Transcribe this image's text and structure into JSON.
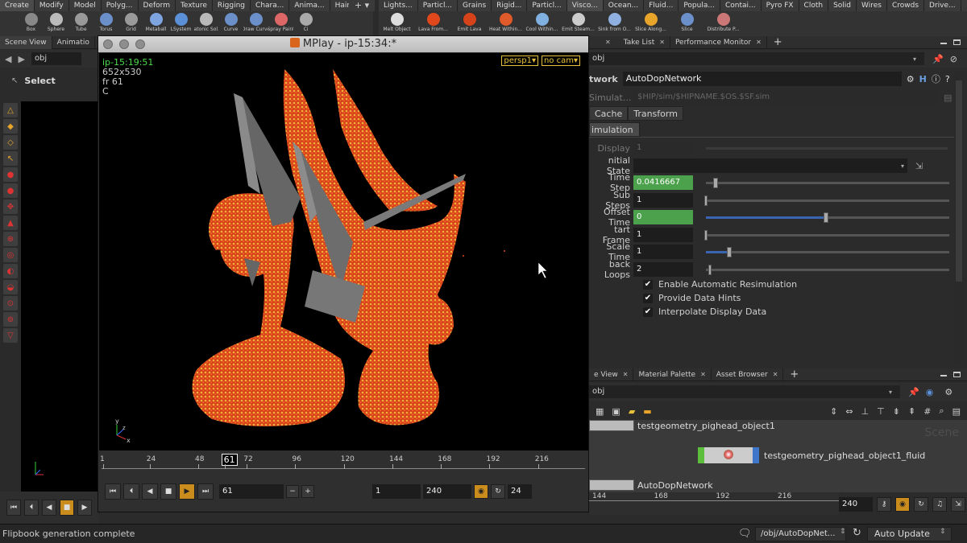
{
  "shelf_left": {
    "tabs": [
      "Create",
      "Modify",
      "Model",
      "Polyg...",
      "Deform",
      "Texture",
      "Rigging",
      "Chara...",
      "Anima...",
      "Hair"
    ],
    "tools": [
      "Box",
      "Sphere",
      "Tube",
      "Torus",
      "Grid",
      "Metaball",
      "LSystem",
      "Platonic Sol...",
      "Curve",
      "Draw Curve",
      "Spray Paint",
      "Ci"
    ]
  },
  "shelf_right": {
    "tabs": [
      "Lights...",
      "Particl...",
      "Grains",
      "Rigid...",
      "Particl...",
      "Visco...",
      "Ocean...",
      "Fluid...",
      "Popula...",
      "Contai...",
      "Pyro FX",
      "Cloth",
      "Solid",
      "Wires",
      "Crowds",
      "Drive..."
    ],
    "tools": [
      "Melt Object",
      "Lava From...",
      "Emit Lava",
      "Heat Within...",
      "Cool Within...",
      "Emit Steam...",
      "Sink from O...",
      "Slice Along...",
      "Slice",
      "Distribute P..."
    ]
  },
  "left_pane": {
    "tabs": [
      "Scene View",
      "Animatio"
    ],
    "path": "obj",
    "select_label": "Select",
    "axis_label": "x y z"
  },
  "mplay": {
    "title": "MPlay - ip-15:34:*",
    "overlay": {
      "name": "ip-15:19:51",
      "res": "652x530",
      "frame": "fr 61",
      "channel": "C"
    },
    "cam_menu": [
      "persp1▾",
      "no cam▾"
    ],
    "timeline_ticks": [
      "1",
      "24",
      "48",
      "61",
      "72",
      "96",
      "120",
      "144",
      "168",
      "192",
      "216"
    ],
    "current_frame_marker": "61",
    "frame_field": "61",
    "start_field": "1",
    "end_field": "240",
    "fps_field": "24"
  },
  "right_top": {
    "tabs": [
      "Take List",
      "Performance Monitor"
    ],
    "path": "obj",
    "node_type": "AutoDopNetwork",
    "node_label": "twork",
    "simulat_label": "Simulat...",
    "simulat_value": "$HIP/sim/$HIPNAME.$OS.$SF.sim",
    "subtabs": [
      "Cache",
      "Transform"
    ],
    "section_tab": "imulation",
    "params": [
      {
        "label": "Display",
        "value": "1"
      },
      {
        "label": "nitial State",
        "value": ""
      },
      {
        "label": "Time Step",
        "value": "0.0416667"
      },
      {
        "label": "Sub Steps",
        "value": "1"
      },
      {
        "label": "Offset Time",
        "value": "0"
      },
      {
        "label": "tart Frame",
        "value": "1"
      },
      {
        "label": "Scale Time",
        "value": "1"
      },
      {
        "label": "back Loops",
        "value": "2"
      }
    ],
    "checks": [
      "Enable Automatic Resimulation",
      "Provide Data Hints",
      "Interpolate Display Data"
    ]
  },
  "right_bottom": {
    "tabs": [
      "e View",
      "Material Palette",
      "Asset Browser"
    ],
    "path": "obj",
    "nodes": [
      "testgeometry_pighead_object1",
      "testgeometry_pighead_object1_fluid",
      "AutoDopNetwork"
    ],
    "watermark": "Scene",
    "timeline_ticks": [
      "144",
      "168",
      "192",
      "216"
    ],
    "end_frame": "240"
  },
  "status": {
    "message": "Flipbook generation complete",
    "network_path": "/obj/AutoDopNet...",
    "auto_update": "Auto Update"
  },
  "colors": {
    "accent": "#e8a52a",
    "green": "#4ca14c",
    "blue": "#3a63b0"
  }
}
